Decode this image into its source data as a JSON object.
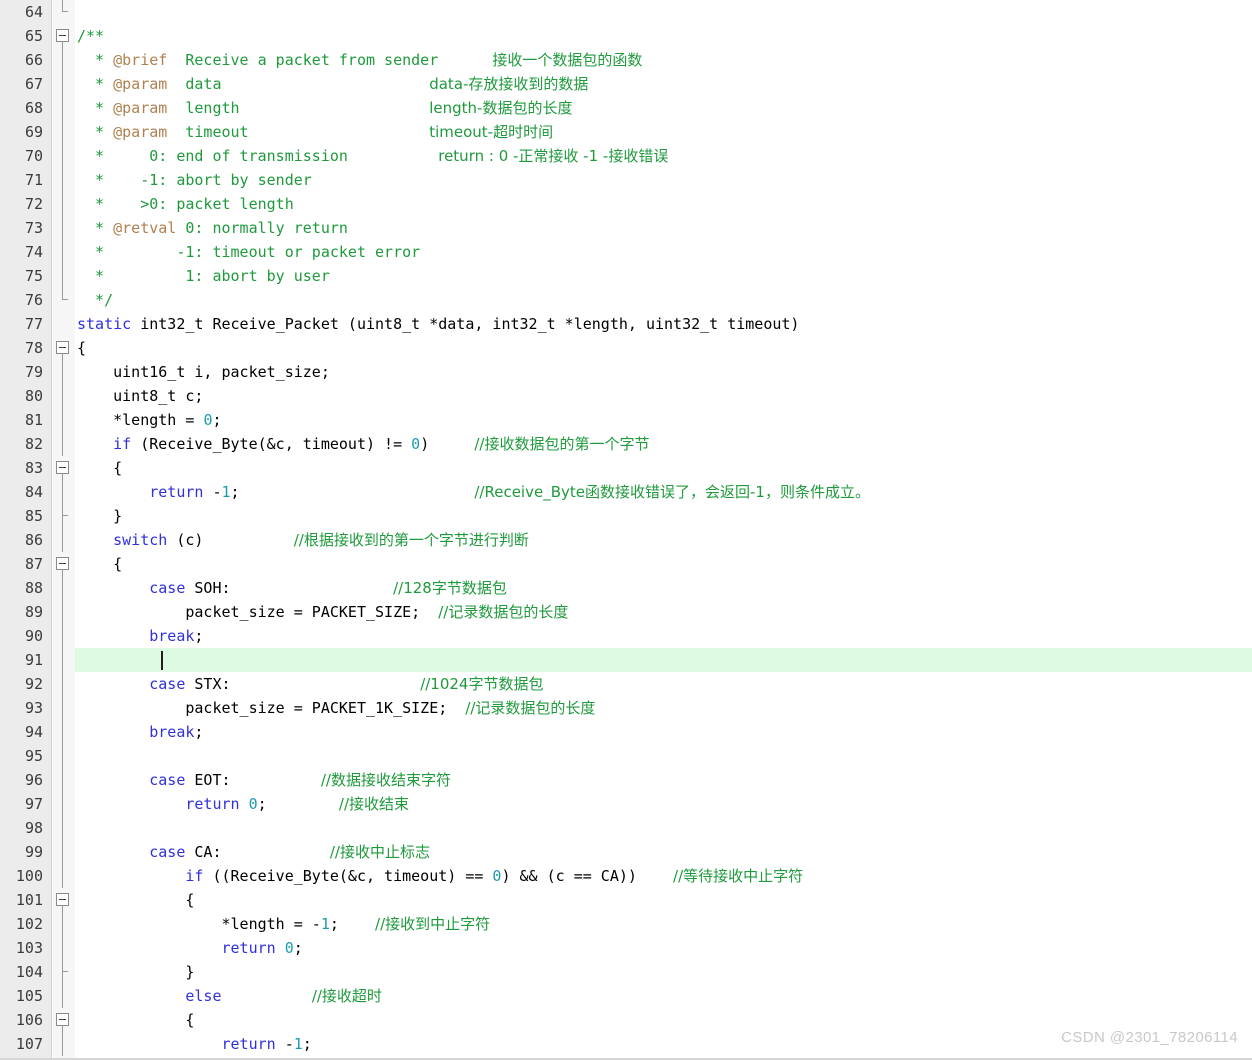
{
  "editor": {
    "first_line": 64,
    "last_line": 107,
    "current_line": 91,
    "watermark": "CSDN @2301_78206114",
    "colors": {
      "gutter_bg": "#ececec",
      "fold_bg": "#f6f6f6",
      "code_bg": "#ffffff",
      "keyword": "#3030dd",
      "number": "#1a9bb0",
      "comment": "#1f9a3c",
      "doc_tag": "#b08050",
      "current_line_highlight": "#ddfbe3",
      "line_number": "#3b3b3b",
      "watermark": "#c8c8c8"
    }
  },
  "lines": [
    {
      "n": 64,
      "fold": "end",
      "segments": []
    },
    {
      "n": 65,
      "fold": "box",
      "segments": [
        {
          "t": "cmt",
          "s": "/**"
        }
      ]
    },
    {
      "n": 66,
      "fold": "bar",
      "segments": [
        {
          "t": "cmt",
          "s": "  * "
        },
        {
          "t": "cmt-tag",
          "s": "@brief"
        },
        {
          "t": "cmt",
          "s": "  Receive a packet from sender      "
        },
        {
          "t": "cn",
          "s": "接收一个数据包的函数"
        }
      ]
    },
    {
      "n": 67,
      "fold": "bar",
      "segments": [
        {
          "t": "cmt",
          "s": "  * "
        },
        {
          "t": "cmt-tag",
          "s": "@param"
        },
        {
          "t": "cmt",
          "s": "  data                       "
        },
        {
          "t": "cn",
          "s": "data-存放接收到的数据"
        }
      ]
    },
    {
      "n": 68,
      "fold": "bar",
      "segments": [
        {
          "t": "cmt",
          "s": "  * "
        },
        {
          "t": "cmt-tag",
          "s": "@param"
        },
        {
          "t": "cmt",
          "s": "  length                     "
        },
        {
          "t": "cn",
          "s": "length-数据包的长度"
        }
      ]
    },
    {
      "n": 69,
      "fold": "bar",
      "segments": [
        {
          "t": "cmt",
          "s": "  * "
        },
        {
          "t": "cmt-tag",
          "s": "@param"
        },
        {
          "t": "cmt",
          "s": "  timeout                    "
        },
        {
          "t": "cn",
          "s": "timeout-超时时间"
        }
      ]
    },
    {
      "n": 70,
      "fold": "bar",
      "segments": [
        {
          "t": "cmt",
          "s": "  *     0: end of transmission          "
        },
        {
          "t": "cn",
          "s": "return : 0 -正常接收 -1 -接收错误"
        }
      ]
    },
    {
      "n": 71,
      "fold": "bar",
      "segments": [
        {
          "t": "cmt",
          "s": "  *    -1: abort by sender"
        }
      ]
    },
    {
      "n": 72,
      "fold": "bar",
      "segments": [
        {
          "t": "cmt",
          "s": "  *    >0: packet length"
        }
      ]
    },
    {
      "n": 73,
      "fold": "bar",
      "segments": [
        {
          "t": "cmt",
          "s": "  * "
        },
        {
          "t": "cmt-tag",
          "s": "@retval"
        },
        {
          "t": "cmt",
          "s": " 0: normally return"
        }
      ]
    },
    {
      "n": 74,
      "fold": "bar",
      "segments": [
        {
          "t": "cmt",
          "s": "  *        -1: timeout or packet error"
        }
      ]
    },
    {
      "n": 75,
      "fold": "bar",
      "segments": [
        {
          "t": "cmt",
          "s": "  *         1: abort by user"
        }
      ]
    },
    {
      "n": 76,
      "fold": "end",
      "segments": [
        {
          "t": "cmt",
          "s": "  */"
        }
      ]
    },
    {
      "n": 77,
      "fold": "none",
      "segments": [
        {
          "t": "kw",
          "s": "static"
        },
        {
          "t": "plain",
          "s": " int32_t Receive_Packet (uint8_t *data, int32_t *length, uint32_t timeout)"
        }
      ]
    },
    {
      "n": 78,
      "fold": "box",
      "segments": [
        {
          "t": "plain",
          "s": "{"
        }
      ]
    },
    {
      "n": 79,
      "fold": "bar",
      "segments": [
        {
          "t": "plain",
          "s": "    uint16_t i, packet_size;"
        }
      ]
    },
    {
      "n": 80,
      "fold": "bar",
      "segments": [
        {
          "t": "plain",
          "s": "    uint8_t c;"
        }
      ]
    },
    {
      "n": 81,
      "fold": "bar",
      "segments": [
        {
          "t": "plain",
          "s": "    *length = "
        },
        {
          "t": "num",
          "s": "0"
        },
        {
          "t": "plain",
          "s": ";"
        }
      ]
    },
    {
      "n": 82,
      "fold": "bar",
      "segments": [
        {
          "t": "plain",
          "s": "    "
        },
        {
          "t": "kw",
          "s": "if"
        },
        {
          "t": "plain",
          "s": " (Receive_Byte(&c, timeout) != "
        },
        {
          "t": "num",
          "s": "0"
        },
        {
          "t": "plain",
          "s": ")     "
        },
        {
          "t": "cn",
          "s": "//接收数据包的第一个字节"
        }
      ]
    },
    {
      "n": 83,
      "fold": "box",
      "segments": [
        {
          "t": "plain",
          "s": "    {"
        }
      ]
    },
    {
      "n": 84,
      "fold": "bar",
      "segments": [
        {
          "t": "plain",
          "s": "        "
        },
        {
          "t": "kw",
          "s": "return"
        },
        {
          "t": "plain",
          "s": " -"
        },
        {
          "t": "num",
          "s": "1"
        },
        {
          "t": "plain",
          "s": ";                          "
        },
        {
          "t": "cn",
          "s": "//Receive_Byte函数接收错误了，会返回-1，则条件成立。"
        }
      ]
    },
    {
      "n": 85,
      "fold": "tick",
      "segments": [
        {
          "t": "plain",
          "s": "    }"
        }
      ]
    },
    {
      "n": 86,
      "fold": "bar",
      "segments": [
        {
          "t": "plain",
          "s": "    "
        },
        {
          "t": "kw",
          "s": "switch"
        },
        {
          "t": "plain",
          "s": " (c)          "
        },
        {
          "t": "cn",
          "s": "//根据接收到的第一个字节进行判断"
        }
      ]
    },
    {
      "n": 87,
      "fold": "box",
      "segments": [
        {
          "t": "plain",
          "s": "    {"
        }
      ]
    },
    {
      "n": 88,
      "fold": "bar",
      "segments": [
        {
          "t": "plain",
          "s": "        "
        },
        {
          "t": "kw",
          "s": "case"
        },
        {
          "t": "plain",
          "s": " SOH:                  "
        },
        {
          "t": "cn",
          "s": "//128字节数据包"
        }
      ]
    },
    {
      "n": 89,
      "fold": "bar",
      "segments": [
        {
          "t": "plain",
          "s": "            packet_size = PACKET_SIZE;  "
        },
        {
          "t": "cn",
          "s": "//记录数据包的长度"
        }
      ]
    },
    {
      "n": 90,
      "fold": "bar",
      "segments": [
        {
          "t": "plain",
          "s": "        "
        },
        {
          "t": "kw",
          "s": "break"
        },
        {
          "t": "plain",
          "s": ";"
        }
      ]
    },
    {
      "n": 91,
      "fold": "bar",
      "segments": [
        {
          "t": "plain",
          "s": "        "
        }
      ],
      "caret": true,
      "current": true
    },
    {
      "n": 92,
      "fold": "bar",
      "segments": [
        {
          "t": "plain",
          "s": "        "
        },
        {
          "t": "kw",
          "s": "case"
        },
        {
          "t": "plain",
          "s": " STX:                     "
        },
        {
          "t": "cn",
          "s": "//1024字节数据包"
        }
      ]
    },
    {
      "n": 93,
      "fold": "bar",
      "segments": [
        {
          "t": "plain",
          "s": "            packet_size = PACKET_1K_SIZE;  "
        },
        {
          "t": "cn",
          "s": "//记录数据包的长度"
        }
      ]
    },
    {
      "n": 94,
      "fold": "bar",
      "segments": [
        {
          "t": "plain",
          "s": "        "
        },
        {
          "t": "kw",
          "s": "break"
        },
        {
          "t": "plain",
          "s": ";"
        }
      ]
    },
    {
      "n": 95,
      "fold": "bar",
      "segments": []
    },
    {
      "n": 96,
      "fold": "bar",
      "segments": [
        {
          "t": "plain",
          "s": "        "
        },
        {
          "t": "kw",
          "s": "case"
        },
        {
          "t": "plain",
          "s": " EOT:          "
        },
        {
          "t": "cn",
          "s": "//数据接收结束字符"
        }
      ]
    },
    {
      "n": 97,
      "fold": "bar",
      "segments": [
        {
          "t": "plain",
          "s": "            "
        },
        {
          "t": "kw",
          "s": "return"
        },
        {
          "t": "plain",
          "s": " "
        },
        {
          "t": "num",
          "s": "0"
        },
        {
          "t": "plain",
          "s": ";        "
        },
        {
          "t": "cn",
          "s": "//接收结束"
        }
      ]
    },
    {
      "n": 98,
      "fold": "bar",
      "segments": []
    },
    {
      "n": 99,
      "fold": "bar",
      "segments": [
        {
          "t": "plain",
          "s": "        "
        },
        {
          "t": "kw",
          "s": "case"
        },
        {
          "t": "plain",
          "s": " CA:            "
        },
        {
          "t": "cn",
          "s": "//接收中止标志"
        }
      ]
    },
    {
      "n": 100,
      "fold": "bar",
      "segments": [
        {
          "t": "plain",
          "s": "            "
        },
        {
          "t": "kw",
          "s": "if"
        },
        {
          "t": "plain",
          "s": " ((Receive_Byte(&c, timeout) == "
        },
        {
          "t": "num",
          "s": "0"
        },
        {
          "t": "plain",
          "s": ") && (c == CA))    "
        },
        {
          "t": "cn",
          "s": "//等待接收中止字符"
        }
      ]
    },
    {
      "n": 101,
      "fold": "box",
      "segments": [
        {
          "t": "plain",
          "s": "            {"
        }
      ]
    },
    {
      "n": 102,
      "fold": "bar",
      "segments": [
        {
          "t": "plain",
          "s": "                *length = -"
        },
        {
          "t": "num",
          "s": "1"
        },
        {
          "t": "plain",
          "s": ";    "
        },
        {
          "t": "cn",
          "s": "//接收到中止字符"
        }
      ]
    },
    {
      "n": 103,
      "fold": "bar",
      "segments": [
        {
          "t": "plain",
          "s": "                "
        },
        {
          "t": "kw",
          "s": "return"
        },
        {
          "t": "plain",
          "s": " "
        },
        {
          "t": "num",
          "s": "0"
        },
        {
          "t": "plain",
          "s": ";"
        }
      ]
    },
    {
      "n": 104,
      "fold": "tick",
      "segments": [
        {
          "t": "plain",
          "s": "            }"
        }
      ]
    },
    {
      "n": 105,
      "fold": "bar",
      "segments": [
        {
          "t": "plain",
          "s": "            "
        },
        {
          "t": "kw",
          "s": "else"
        },
        {
          "t": "plain",
          "s": "          "
        },
        {
          "t": "cn",
          "s": "//接收超时"
        }
      ]
    },
    {
      "n": 106,
      "fold": "box",
      "segments": [
        {
          "t": "plain",
          "s": "            {"
        }
      ]
    },
    {
      "n": 107,
      "fold": "bar",
      "segments": [
        {
          "t": "plain",
          "s": "                "
        },
        {
          "t": "kw",
          "s": "return"
        },
        {
          "t": "plain",
          "s": " -"
        },
        {
          "t": "num",
          "s": "1"
        },
        {
          "t": "plain",
          "s": ";"
        }
      ]
    }
  ]
}
